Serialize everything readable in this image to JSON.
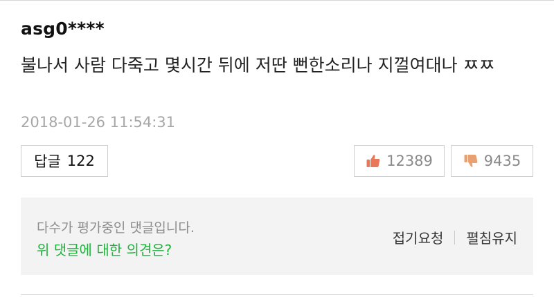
{
  "comment": {
    "username": "asg0****",
    "text": "불나서 사람 다죽고 몇시간 뒤에 저딴 뻔한소리나 지껄여대나 ㅉㅉ",
    "timestamp": "2018-01-26 11:54:31"
  },
  "reply": {
    "label": "답글",
    "count": "122"
  },
  "votes": {
    "like_count": "12389",
    "dislike_count": "9435",
    "like_icon": "thumbs-up-icon",
    "dislike_icon": "thumbs-down-icon"
  },
  "evaluation": {
    "notice": "다수가 평가중인 댓글입니다.",
    "question": "위 댓글에 대한 의견은?",
    "fold_request_label": "접기요청",
    "keep_open_label": "펼침유지"
  },
  "colors": {
    "accent_green": "#1fb23c",
    "like_icon": "#e9785b",
    "dislike_icon": "#e8a173"
  }
}
